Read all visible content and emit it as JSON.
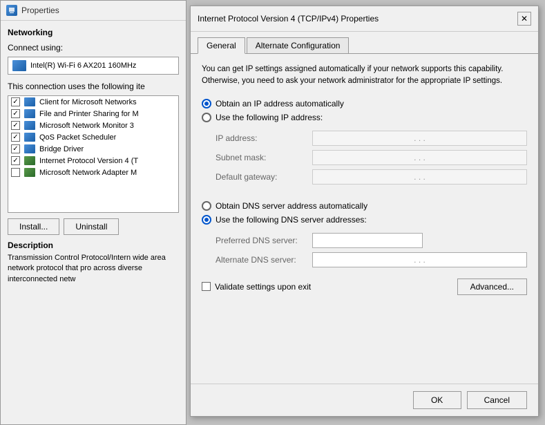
{
  "bg_window": {
    "title": "Properties",
    "networking_label": "Networking",
    "connect_using_label": "Connect using:",
    "adapter_name": "Intel(R) Wi-Fi 6 AX201 160MHz",
    "connection_items_label": "This connection uses the following ite",
    "list_items": [
      {
        "checked": true,
        "label": "Client for Microsoft Networks"
      },
      {
        "checked": true,
        "label": "File and Printer Sharing for M"
      },
      {
        "checked": true,
        "label": "Microsoft Network Monitor 3"
      },
      {
        "checked": true,
        "label": "QoS Packet Scheduler"
      },
      {
        "checked": true,
        "label": "Bridge Driver"
      },
      {
        "checked": true,
        "label": "Internet Protocol Version 4 (T"
      },
      {
        "checked": false,
        "label": "Microsoft Network Adapter M"
      }
    ],
    "install_btn": "Install...",
    "uninstall_btn": "Uninstall",
    "description_label": "Description",
    "description_text": "Transmission Control Protocol/Intern wide area network protocol that pro across diverse interconnected netw"
  },
  "dialog": {
    "title": "Internet Protocol Version 4 (TCP/IPv4) Properties",
    "close_label": "✕",
    "tabs": [
      {
        "label": "General",
        "active": true
      },
      {
        "label": "Alternate Configuration",
        "active": false
      }
    ],
    "info_text": "You can get IP settings assigned automatically if your network supports this capability. Otherwise, you need to ask your network administrator for the appropriate IP settings.",
    "radio_obtain_ip": "Obtain an IP address automatically",
    "radio_use_ip": "Use the following IP address:",
    "ip_address_label": "IP address:",
    "ip_address_value": ". . .",
    "subnet_mask_label": "Subnet mask:",
    "subnet_mask_value": ". . .",
    "default_gateway_label": "Default gateway:",
    "default_gateway_value": ". . .",
    "radio_obtain_dns": "Obtain DNS server address automatically",
    "radio_use_dns": "Use the following DNS server addresses:",
    "preferred_dns_label": "Preferred DNS server:",
    "preferred_dns_value": "",
    "alternate_dns_label": "Alternate DNS server:",
    "alternate_dns_value": ". . .",
    "validate_label": "Validate settings upon exit",
    "advanced_btn": "Advanced...",
    "ok_btn": "OK",
    "cancel_btn": "Cancel"
  }
}
